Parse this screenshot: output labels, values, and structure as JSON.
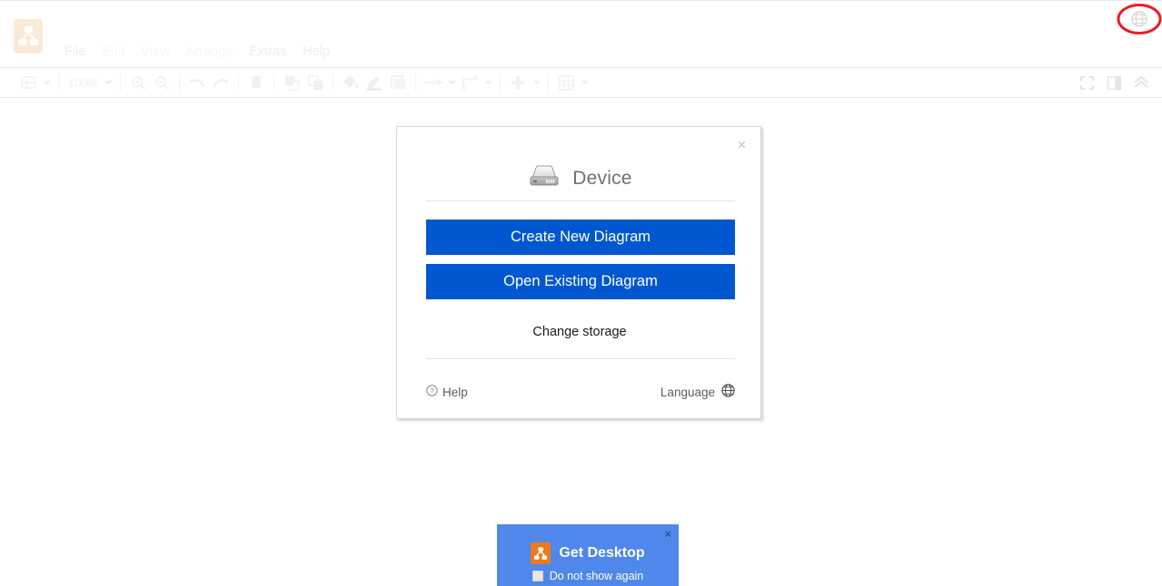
{
  "app": {
    "logo_icon": "drawio-logo-icon",
    "menu": {
      "file": "File",
      "edit": "Edit",
      "view": "View",
      "arrange": "Arrange",
      "extras": "Extras",
      "help": "Help"
    },
    "language_globe_icon": "globe-icon"
  },
  "annotation": {
    "shape": "ellipse",
    "color": "#ec1c24",
    "target": "language-globe-icon"
  },
  "toolbar": {
    "view_layers_icon": "layers-panel-icon",
    "zoom_level": "100%",
    "zoom_in_icon": "zoom-in-icon",
    "zoom_out_icon": "zoom-out-icon",
    "undo_icon": "undo-icon",
    "redo_icon": "redo-icon",
    "delete_icon": "trash-icon",
    "to_front_icon": "bring-to-front-icon",
    "to_back_icon": "send-to-back-icon",
    "fill_color_icon": "fill-color-icon",
    "line_color_icon": "line-color-icon",
    "shadow_icon": "shadow-icon",
    "connection_icon": "connection-arrow-icon",
    "waypoints_icon": "waypoints-icon",
    "insert_icon": "insert-plus-icon",
    "table_icon": "table-grid-icon",
    "fit_page_icon": "fit-page-icon",
    "format_panel_icon": "format-panel-icon",
    "collapse_icon": "chevron-up-icon"
  },
  "splash": {
    "close_label": "×",
    "storage_icon": "hard-drive-icon",
    "storage_title": "Device",
    "create_button": "Create New Diagram",
    "open_button": "Open Existing Diagram",
    "change_storage": "Change storage",
    "help_icon": "help-circle-icon",
    "help_label": "Help",
    "language_label": "Language",
    "language_icon": "globe-icon",
    "accent_color": "#0057d0"
  },
  "desktop_banner": {
    "close_label": "×",
    "logo_icon": "drawio-logo-icon",
    "title": "Get Desktop",
    "checkbox_label": "Do not show again",
    "background_color": "#4f87ea",
    "logo_color": "#ea7b21"
  }
}
